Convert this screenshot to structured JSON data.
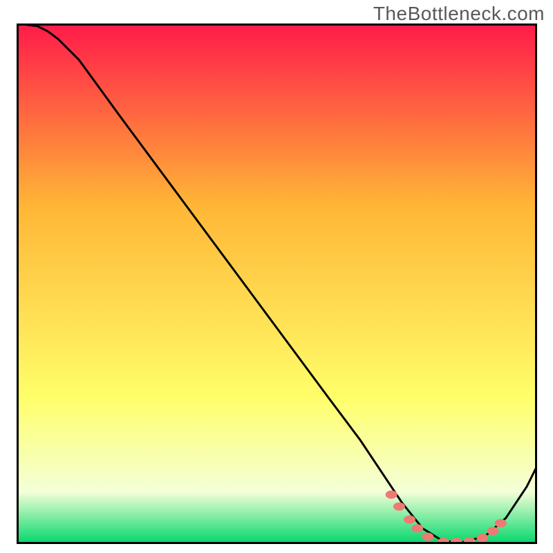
{
  "watermark": "TheBottleneck.com",
  "colors": {
    "gradient_top": "#ff1a4a",
    "gradient_mid": "#ffb636",
    "gradient_low": "#ffff6a",
    "gradient_pale": "#f4ffd8",
    "gradient_bottom": "#00d76a",
    "curve": "#000000",
    "marker": "#ed7b72",
    "border": "#000000"
  },
  "chart_data": {
    "type": "line",
    "title": "",
    "xlabel": "",
    "ylabel": "",
    "xlim": [
      0,
      100
    ],
    "ylim": [
      0,
      100
    ],
    "curve": {
      "x": [
        0,
        4,
        6,
        8,
        12,
        20,
        30,
        40,
        50,
        60,
        66,
        70,
        74,
        78,
        82,
        86,
        90,
        94,
        98,
        100
      ],
      "y": [
        100,
        99.5,
        98.5,
        97,
        93,
        82,
        68.5,
        55,
        41.5,
        28,
        20,
        14,
        8,
        3,
        0.5,
        0.4,
        1.5,
        5,
        11,
        15
      ]
    },
    "markers": {
      "x": [
        72,
        73.5,
        75.5,
        77,
        79,
        82,
        84.5,
        87,
        89.5,
        91.5,
        93
      ],
      "y": [
        9.5,
        7.2,
        4.7,
        3.0,
        1.4,
        0.4,
        0.4,
        0.5,
        1.2,
        2.5,
        4.0
      ]
    },
    "gradient_stops": [
      {
        "offset": 0.0,
        "key": "gradient_top"
      },
      {
        "offset": 0.35,
        "key": "gradient_mid"
      },
      {
        "offset": 0.72,
        "key": "gradient_low"
      },
      {
        "offset": 0.9,
        "key": "gradient_pale"
      },
      {
        "offset": 1.0,
        "key": "gradient_bottom"
      }
    ]
  }
}
